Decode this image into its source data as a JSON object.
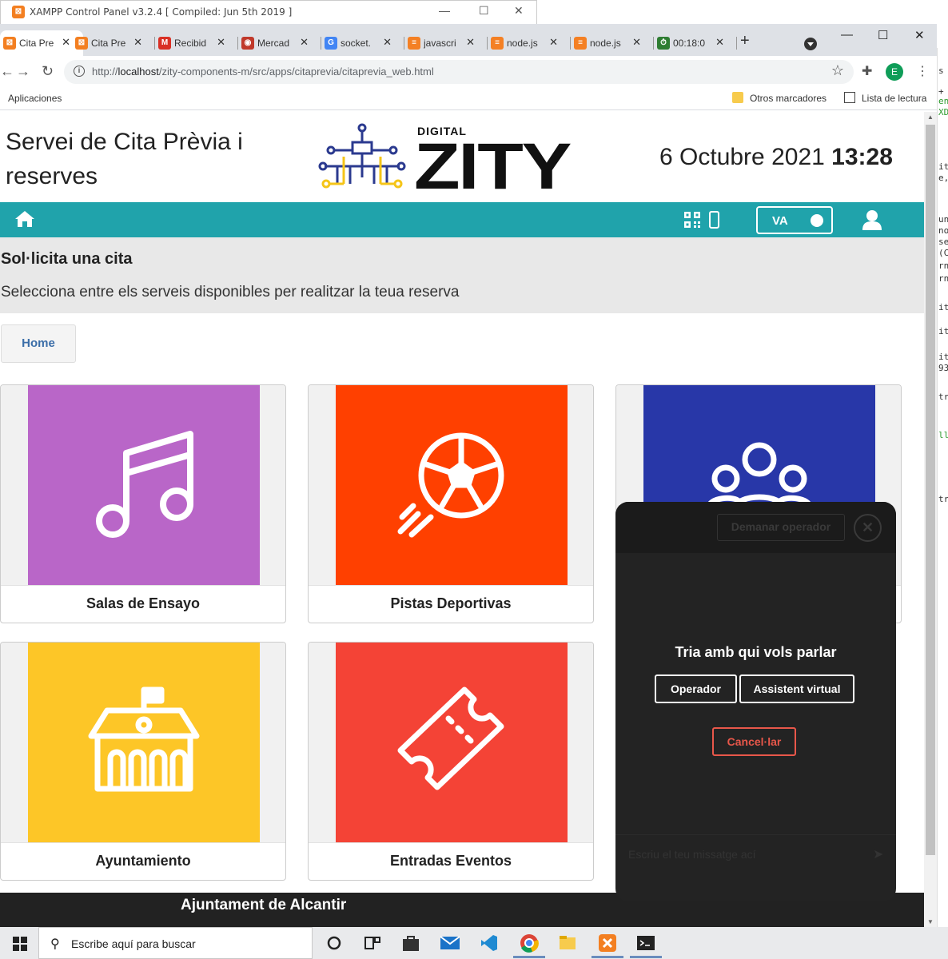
{
  "xampp": {
    "title": "XAMPP Control Panel v3.2.4   [ Compiled: Jun 5th 2019 ]",
    "logo": "xampp-logo"
  },
  "right_strip": [
    "s t",
    " +",
    "en",
    "XD",
    "it",
    "e,",
    "un",
    "no",
    "se",
    "(C",
    "rn",
    "rn",
    "it",
    "it",
    "it",
    "93",
    "tr",
    "ll",
    "tr"
  ],
  "browser": {
    "tabs": [
      {
        "label": "Cita Pre",
        "icon": "xampp-icon",
        "color": "#f37f21",
        "active": true
      },
      {
        "label": "Cita Pre",
        "icon": "xampp-icon",
        "color": "#f37f21"
      },
      {
        "label": "Recibid",
        "icon": "gmail-icon",
        "color": "#d93025"
      },
      {
        "label": "Mercad",
        "icon": "mercado-icon",
        "color": "#c0392b"
      },
      {
        "label": "socket.",
        "icon": "google-icon",
        "color": "#4285f4"
      },
      {
        "label": "javascri",
        "icon": "stackoverflow-icon",
        "color": "#f48024"
      },
      {
        "label": "node.js",
        "icon": "stackoverflow-icon",
        "color": "#f48024"
      },
      {
        "label": "node.js",
        "icon": "stackoverflow-icon",
        "color": "#f48024"
      },
      {
        "label": "00:18:0",
        "icon": "timer-icon",
        "color": "#2e7d32"
      }
    ],
    "new_tab": "+",
    "url_prefix": "http://",
    "url_host": "localhost",
    "url_path": "/zity-components-m/src/apps/citaprevia/citaprevia_web.html",
    "avatar_letter": "E",
    "bookmarks": {
      "apps": "Aplicaciones",
      "other": "Otros marcadores",
      "reading": "Lista de lectura"
    }
  },
  "page": {
    "title": "Servei de Cita Prèvia i reserves",
    "logo_small": "DIGITAL",
    "logo_big": "ZITY",
    "date": "6 Octubre 2021",
    "time": "13:28",
    "accent": "#20a3ab",
    "lang": "VA",
    "banner_title": "Sol·licita una cita",
    "banner_text": "Selecciona entre els serveis disponibles per realitzar la teua reserva",
    "breadcrumb_home": "Home",
    "cards": [
      {
        "label": "Salas de Ensayo",
        "color": "#b966c8",
        "icon": "music-note-icon"
      },
      {
        "label": "Pistas Deportivas",
        "color": "#ff4000",
        "icon": "soccer-ball-icon"
      },
      {
        "label": "",
        "color": "#2837a8",
        "icon": "group-icon"
      },
      {
        "label": "Ayuntamiento",
        "color": "#fdc627",
        "icon": "town-hall-icon"
      },
      {
        "label": "Entradas Eventos",
        "color": "#f44336",
        "icon": "ticket-icon"
      }
    ],
    "footer_text": "Ajuntament de Alcantir"
  },
  "chat": {
    "request_operator": "Demanar operador",
    "question": "Tria amb qui vols parlar",
    "option_operator": "Operador",
    "option_assistant": "Assistent virtual",
    "cancel": "Cancel·lar",
    "input_placeholder": "Escriu el teu missatge ací"
  },
  "taskbar": {
    "search_placeholder": "Escribe aquí para buscar",
    "apps": [
      "cortana-icon",
      "task-view-icon",
      "store-icon",
      "mail-icon",
      "vscode-icon",
      "chrome-icon",
      "file-explorer-icon",
      "xampp-icon",
      "terminal-icon"
    ]
  }
}
